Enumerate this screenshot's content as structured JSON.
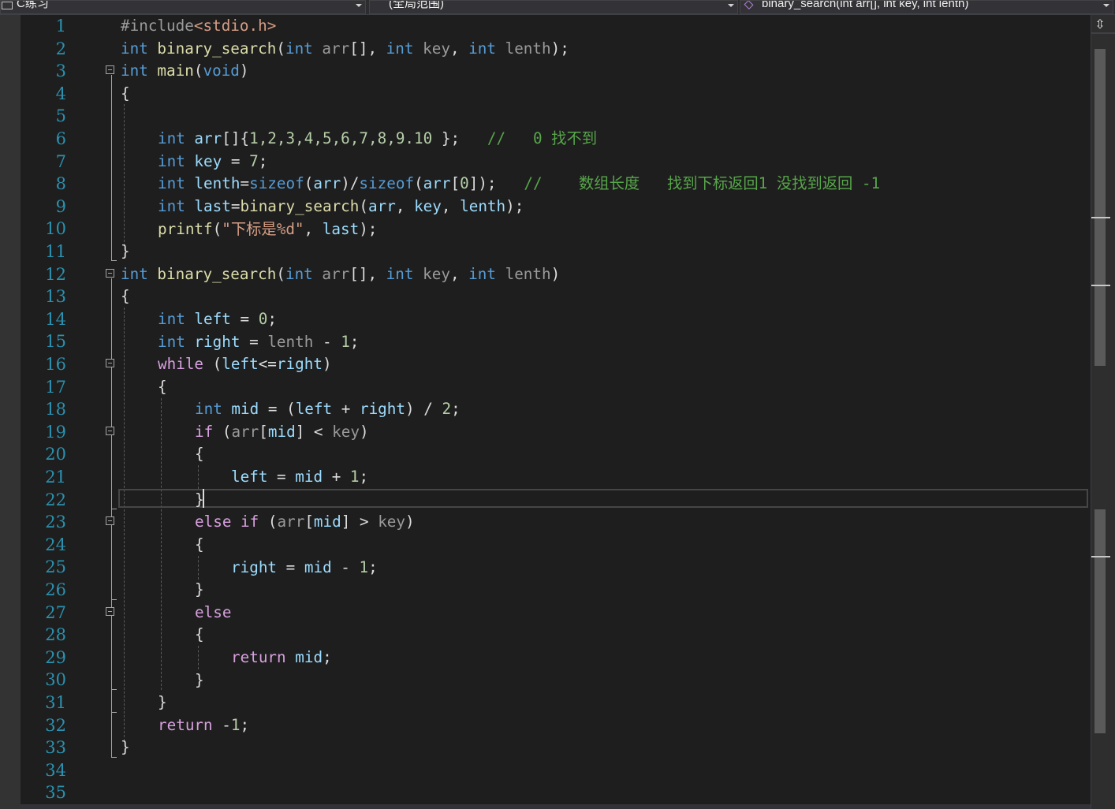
{
  "navigation_bar": {
    "project_dropdown": "C练习",
    "scope_dropdown": "(全局范围)",
    "member_dropdown": "binary_search(int arr[], int key, int lenth)"
  },
  "line_numbers": [
    "1",
    "2",
    "3",
    "4",
    "5",
    "6",
    "7",
    "8",
    "9",
    "10",
    "11",
    "12",
    "13",
    "14",
    "15",
    "16",
    "17",
    "18",
    "19",
    "20",
    "21",
    "22",
    "23",
    "24",
    "25",
    "26",
    "27",
    "28",
    "29",
    "30",
    "31",
    "32",
    "33",
    "34",
    "35"
  ],
  "code": {
    "l1": {
      "pre": "#include",
      "inc": "<stdio.h>"
    },
    "l2": {
      "kw1": "int",
      "fn": " binary_search",
      "p1": "(",
      "kw2": "int",
      "a1": " arr",
      "p2": "[], ",
      "kw3": "int",
      "a2": " key",
      "p3": ", ",
      "kw4": "int",
      "a3": " lenth",
      "p4": ");"
    },
    "l3": {
      "kw1": "int",
      "fn": " main",
      "p1": "(",
      "kw2": "void",
      "p2": ")"
    },
    "l4": {
      "t": "{"
    },
    "l6": {
      "kw": "int",
      "v": " arr",
      "p1": "[]{",
      "n": "1,2,3,4,5,6,7,8,9.10",
      "p2": " };   ",
      "c": "//   0 找不到"
    },
    "l7": {
      "kw": "int",
      "v": " key",
      "p1": " = ",
      "n": "7",
      "p2": ";"
    },
    "l8": {
      "kw": "int",
      "v": " lenth",
      "p1": "=",
      "kw2": "sizeof",
      "p2": "(",
      "v2": "arr",
      "p3": ")/",
      "kw3": "sizeof",
      "p4": "(",
      "v3": "arr",
      "p5": "[",
      "n": "0",
      "p6": "]);   ",
      "c": "//    数组长度   找到下标返回1 没找到返回 -1"
    },
    "l9": {
      "kw": "int",
      "v": " last",
      "p1": "=",
      "fn": "binary_search",
      "p2": "(",
      "v2": "arr",
      "p3": ", ",
      "v3": "key",
      "p4": ", ",
      "v4": "lenth",
      "p5": ");"
    },
    "l10": {
      "fn": "printf",
      "p1": "(",
      "s": "\"下标是%d\"",
      "p2": ", ",
      "v": "last",
      "p3": ");"
    },
    "l11": {
      "t": "}"
    },
    "l12": {
      "kw1": "int",
      "fn": " binary_search",
      "p1": "(",
      "kw2": "int",
      "a1": " arr",
      "p2": "[], ",
      "kw3": "int",
      "a2": " key",
      "p3": ", ",
      "kw4": "int",
      "a3": " lenth",
      "p4": ")"
    },
    "l13": {
      "t": "{"
    },
    "l14": {
      "kw": "int",
      "v": " left",
      "p1": " = ",
      "n": "0",
      "p2": ";"
    },
    "l15": {
      "kw": "int",
      "v": " right",
      "p1": " = ",
      "v2": "lenth",
      "p2": " - ",
      "n": "1",
      "p3": ";"
    },
    "l16": {
      "ctrl": "while",
      "p1": " (",
      "v": "left",
      "p2": "<=",
      "v2": "right",
      "p3": ")"
    },
    "l17": {
      "t": "{"
    },
    "l18": {
      "kw": "int",
      "v": " mid",
      "p1": " = (",
      "v2": "left",
      "p2": " + ",
      "v3": "right",
      "p3": ") / ",
      "n": "2",
      "p4": ";"
    },
    "l19": {
      "ctrl": "if",
      "p1": " (",
      "v": "arr",
      "p2": "[",
      "v2": "mid",
      "p3": "] < ",
      "v3": "key",
      "p4": ")"
    },
    "l20": {
      "t": "{"
    },
    "l21": {
      "v": "left",
      "p1": " = ",
      "v2": "mid",
      "p2": " + ",
      "n": "1",
      "p3": ";"
    },
    "l22": {
      "t": "}"
    },
    "l23": {
      "ctrl": "else if",
      "p1": " (",
      "v": "arr",
      "p2": "[",
      "v2": "mid",
      "p3": "] > ",
      "v3": "key",
      "p4": ")"
    },
    "l24": {
      "t": "{"
    },
    "l25": {
      "v": "right",
      "p1": " = ",
      "v2": "mid",
      "p2": " - ",
      "n": "1",
      "p3": ";"
    },
    "l26": {
      "t": "}"
    },
    "l27": {
      "ctrl": "else"
    },
    "l28": {
      "t": "{"
    },
    "l29": {
      "ctrl": "return",
      "p1": " ",
      "v": "mid",
      "p2": ";"
    },
    "l30": {
      "t": "}"
    },
    "l31": {
      "t": "}"
    },
    "l32": {
      "ctrl": "return",
      "p1": " -",
      "n": "1",
      "p2": ";"
    },
    "l33": {
      "t": "}"
    }
  },
  "colors": {
    "background": "#1e1e1e",
    "keyword": "#569cd6",
    "control": "#d8a0df",
    "function": "#dcdcaa",
    "variable": "#9cdcfe",
    "number": "#b5cea8",
    "string": "#d69d85",
    "comment": "#57a64a",
    "line_number": "#2b91af"
  },
  "icons": {
    "project": "csharp-project-icon",
    "member": "method-cube-icon",
    "split": "split-window-icon"
  }
}
